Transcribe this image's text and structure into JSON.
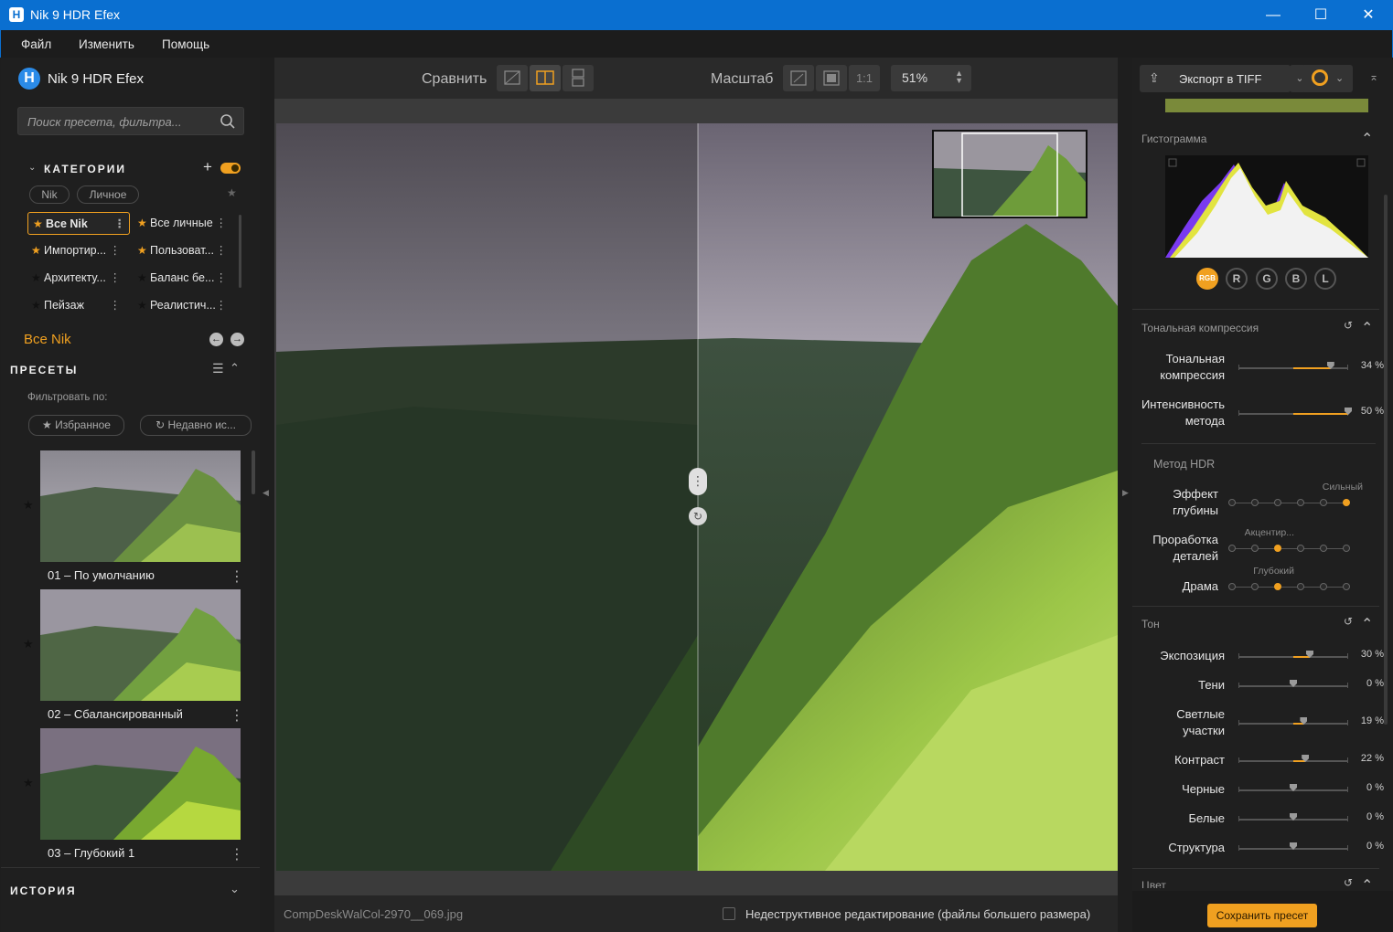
{
  "window": {
    "title": "Nik 9 HDR Efex",
    "app_icon": "H",
    "minimize": "—",
    "maximize": "☐",
    "close": "✕"
  },
  "menu": [
    "Файл",
    "Изменить",
    "Помощь"
  ],
  "left": {
    "brand": "Nik 9 HDR Efex",
    "search_placeholder": "Поиск пресета, фильтра...",
    "categories": {
      "header": "КАТЕГОРИИ",
      "add": "+",
      "tabs": [
        "Nik",
        "Личное"
      ],
      "items_left": [
        {
          "label": "Все Nik",
          "selected": true,
          "fav": true
        },
        {
          "label": "Импортир...",
          "fav": true
        },
        {
          "label": "Архитекту...",
          "fav": false
        },
        {
          "label": "Пейзаж",
          "fav": false
        }
      ],
      "items_right": [
        {
          "label": "Все личные",
          "fav": true
        },
        {
          "label": "Пользоват...",
          "fav": true
        },
        {
          "label": "Баланс бе...",
          "fav": false
        },
        {
          "label": "Реалистич...",
          "fav": false
        }
      ]
    },
    "current": "Все Nik",
    "presets": {
      "header": "ПРЕСЕТЫ",
      "filter_label": "Фильтровать по:",
      "filters": [
        "Избранное",
        "Недавно ис..."
      ],
      "items": [
        "01 – По умолчанию",
        "02 – Сбалансированный",
        "03 – Глубокий 1"
      ]
    },
    "history": "ИСТОРИЯ"
  },
  "toolbar": {
    "compare": "Сравнить",
    "zoom": "Масштаб",
    "one_to_one": "1:1",
    "zoom_value": "51%"
  },
  "status": {
    "filename": "CompDeskWalCol-2970__069.jpg",
    "nondestructive": "Недеструктивное редактирование (файлы большего размера)"
  },
  "right": {
    "export": "Экспорт в TIFF",
    "histogram": {
      "title": "Гистограмма",
      "channels": [
        "RGB",
        "R",
        "G",
        "B",
        "L"
      ]
    },
    "tonal": {
      "title": "Тональная компрессия",
      "sliders": [
        {
          "label": "Тональная\nкомпрессия",
          "value": "34 %",
          "level": 0.34
        },
        {
          "label": "Интенсивность\nметода",
          "value": "50 %",
          "level": 0.5
        }
      ]
    },
    "hdr": {
      "title": "Метод HDR",
      "sliders": [
        {
          "label": "Эффект\nглубины",
          "tag": "Сильный",
          "step": 5
        },
        {
          "label": "Проработка\nдеталей",
          "tag": "Акцентир...",
          "step": 2
        },
        {
          "label": "Драма",
          "tag": "Глубокий",
          "step": 2
        }
      ]
    },
    "tone": {
      "title": "Тон",
      "sliders": [
        {
          "label": "Экспозиция",
          "value": "30 %",
          "level": 0.15
        },
        {
          "label": "Тени",
          "value": "0 %",
          "level": 0
        },
        {
          "label": "Светлые\nучастки",
          "value": "19 %",
          "level": 0.095
        },
        {
          "label": "Контраст",
          "value": "22 %",
          "level": 0.11
        },
        {
          "label": "Черные",
          "value": "0 %",
          "level": 0
        },
        {
          "label": "Белые",
          "value": "0 %",
          "level": 0
        },
        {
          "label": "Структура",
          "value": "0 %",
          "level": 0
        }
      ]
    },
    "color_title": "Цвет",
    "save_preset": "Сохранить пресет"
  },
  "colors": {
    "accent": "#f0a020",
    "titlebar": "#0a6fd0",
    "panel": "#1f1f1f"
  }
}
